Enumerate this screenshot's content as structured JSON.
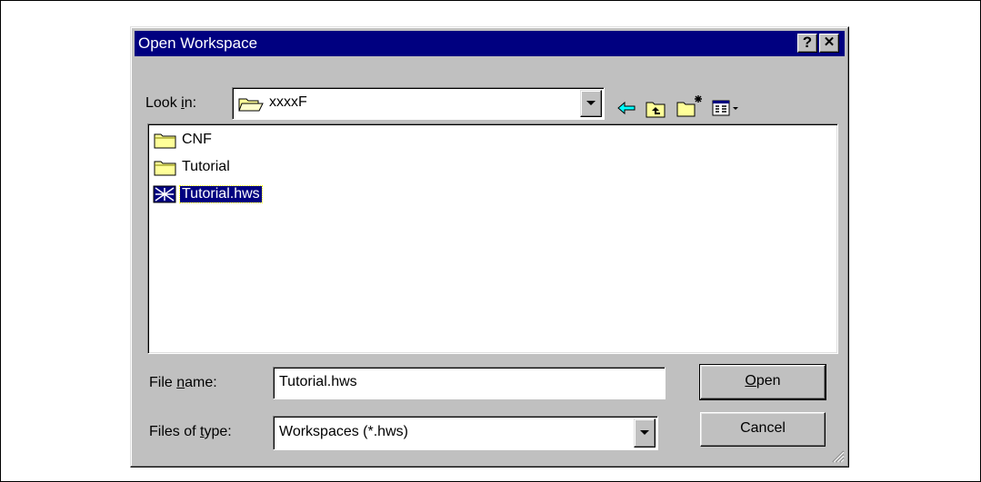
{
  "dialog": {
    "title": "Open Workspace",
    "help_label": "?",
    "close_label": "✕"
  },
  "look_in": {
    "label_pre": "Look ",
    "label_accel": "i",
    "label_post": "n:",
    "value": "xxxxF"
  },
  "toolbar": {
    "icons": [
      "back-arrow-icon",
      "up-one-level-icon",
      "create-new-folder-icon",
      "view-menu-icon"
    ]
  },
  "files": [
    {
      "name": "CNF",
      "icon": "folder-icon",
      "selected": false
    },
    {
      "name": "Tutorial",
      "icon": "folder-icon",
      "selected": false
    },
    {
      "name": "Tutorial.hws",
      "icon": "workspace-file-icon",
      "selected": true
    }
  ],
  "file_name": {
    "label_pre": "File ",
    "label_accel": "n",
    "label_post": "ame:",
    "value": "Tutorial.hws"
  },
  "file_type": {
    "label_pre": "Files of ",
    "label_accel": "t",
    "label_post": "ype:",
    "value": "Workspaces (*.hws)"
  },
  "buttons": {
    "open_accel": "O",
    "open_rest": "pen",
    "cancel": "Cancel"
  },
  "colors": {
    "titlebar": "#000080",
    "face": "#c0c0c0",
    "folder": "#ffff99"
  }
}
